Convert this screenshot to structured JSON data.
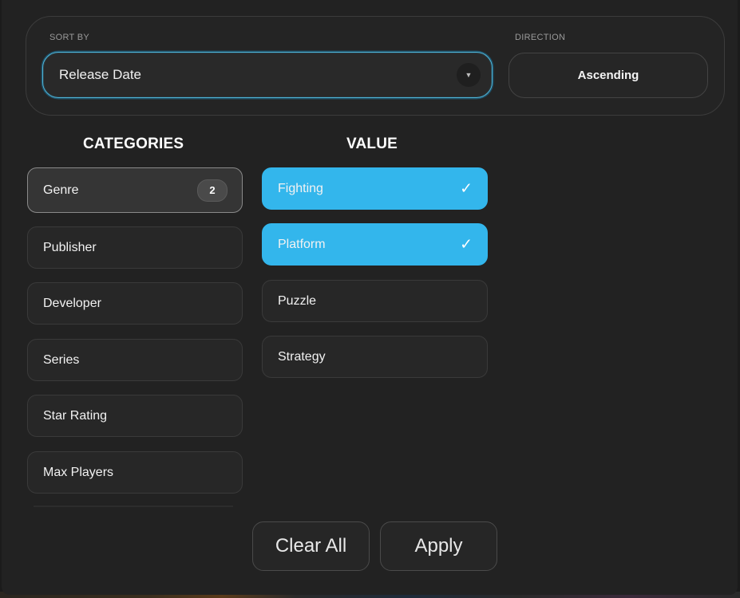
{
  "sort": {
    "label": "SORT BY",
    "selected": "Release Date",
    "caret_icon": "chevron-down-icon"
  },
  "direction": {
    "label": "DIRECTION",
    "value": "Ascending"
  },
  "categories": {
    "heading": "CATEGORIES",
    "items": [
      {
        "label": "Genre",
        "count": "2",
        "active": true
      },
      {
        "label": "Publisher"
      },
      {
        "label": "Developer"
      },
      {
        "label": "Series"
      },
      {
        "label": "Star Rating"
      },
      {
        "label": "Max Players"
      }
    ]
  },
  "values": {
    "heading": "VALUE",
    "items": [
      {
        "label": "Fighting",
        "selected": true
      },
      {
        "label": "Platform",
        "selected": true
      },
      {
        "label": "Puzzle",
        "selected": false
      },
      {
        "label": "Strategy",
        "selected": false
      }
    ],
    "check_glyph": "✓"
  },
  "footer": {
    "clear_label": "Clear All",
    "apply_label": "Apply"
  },
  "colors": {
    "accent": "#33b6ec",
    "focus_ring": "#4fb6d8",
    "panel_bg": "#222222"
  }
}
